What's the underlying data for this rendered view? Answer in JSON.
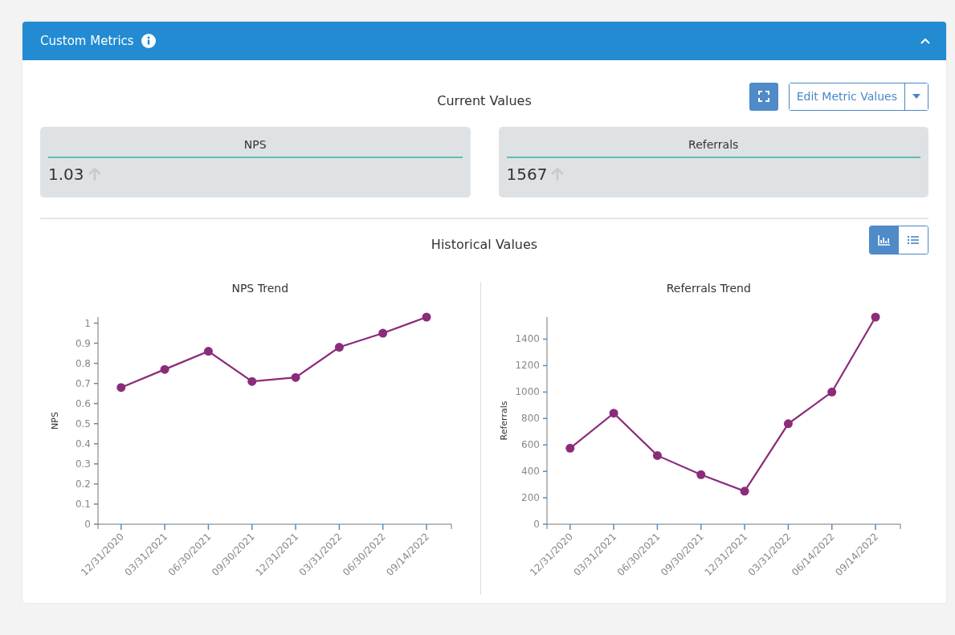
{
  "panel": {
    "title": "Custom Metrics",
    "expanded": true
  },
  "current_values": {
    "heading": "Current Values",
    "edit_button": "Edit Metric Values",
    "metrics": [
      {
        "name": "NPS",
        "value": "1.03",
        "rising": true
      },
      {
        "name": "Referrals",
        "value": "1567",
        "rising": true
      }
    ]
  },
  "historical_values": {
    "heading": "Historical Values",
    "view_toggle": [
      {
        "kind": "chart",
        "selected": true
      },
      {
        "kind": "list",
        "selected": false
      }
    ],
    "charts": [
      {
        "chart_data": {
          "type": "line",
          "title": "NPS Trend",
          "ylabel": "NPS",
          "categories": [
            "12/31/2020",
            "03/31/2021",
            "06/30/2021",
            "09/30/2021",
            "12/31/2021",
            "03/31/2022",
            "06/30/2022",
            "09/14/2022"
          ],
          "series": [
            {
              "color": "#8b2c7a",
              "marker": true,
              "values": [
                0.68,
                0.77,
                0.86,
                0.71,
                0.73,
                0.88,
                0.95,
                1.03
              ]
            }
          ],
          "ylim": [
            0,
            1.03
          ],
          "yticks": [
            0,
            0.1,
            0.2,
            0.3,
            0.4,
            0.5,
            0.6,
            0.7,
            0.8,
            0.9,
            1
          ]
        }
      },
      {
        "chart_data": {
          "type": "line",
          "title": "Referrals Trend",
          "ylabel": "Referrals",
          "categories": [
            "12/31/2020",
            "03/31/2021",
            "06/30/2021",
            "09/30/2021",
            "12/31/2021",
            "03/31/2022",
            "06/14/2022",
            "09/14/2022"
          ],
          "series": [
            {
              "color": "#8b2c7a",
              "marker": true,
              "values": [
                575,
                840,
                520,
                375,
                250,
                760,
                1000,
                1567
              ]
            }
          ],
          "ylim": [
            0,
            1567
          ],
          "yticks": [
            0,
            200,
            400,
            600,
            800,
            1000,
            1200,
            1400
          ]
        }
      }
    ]
  }
}
